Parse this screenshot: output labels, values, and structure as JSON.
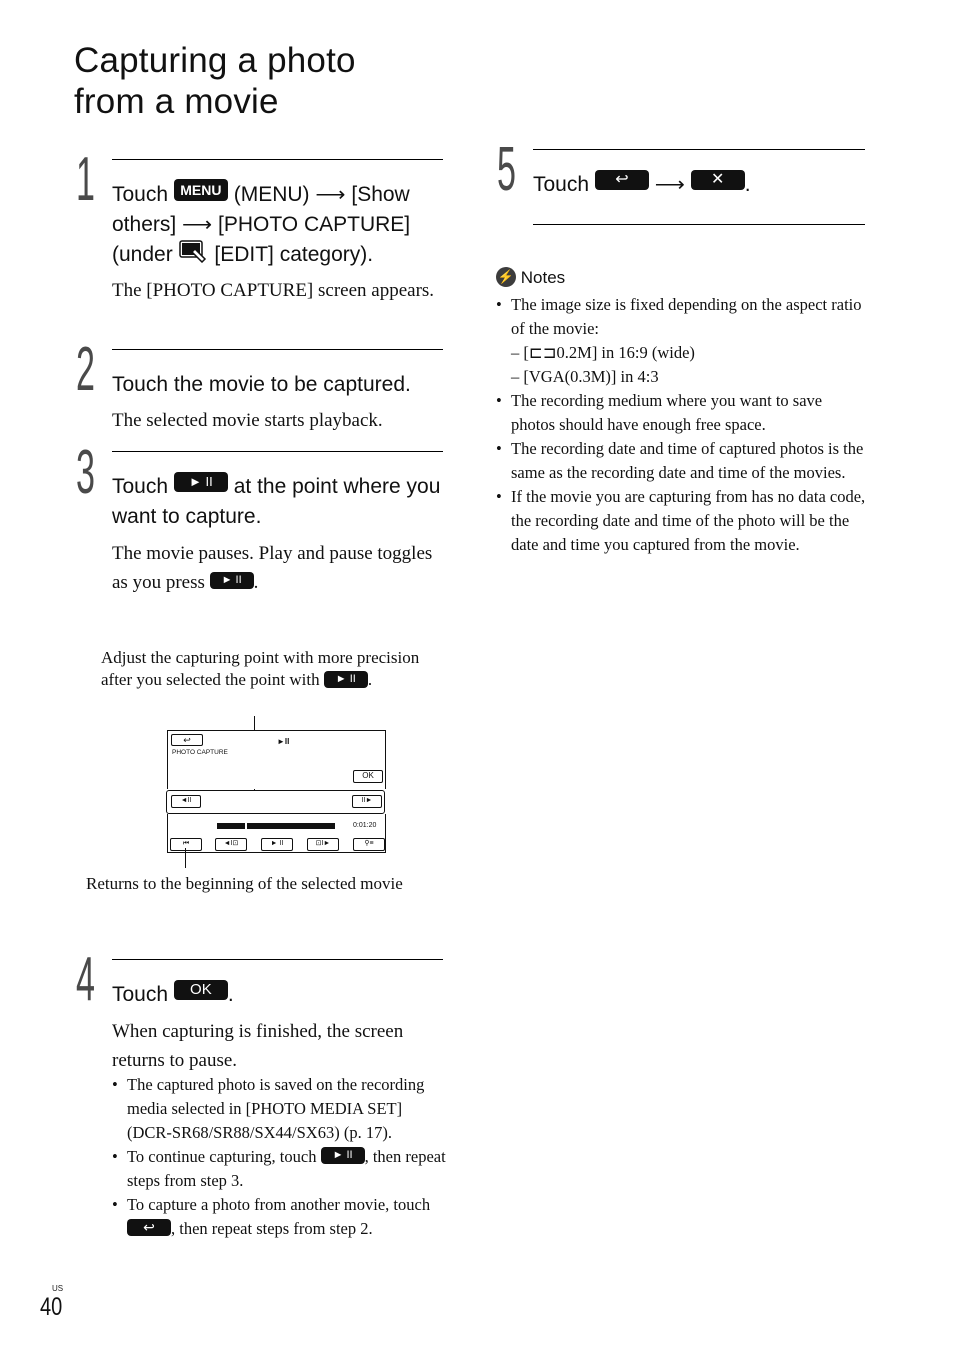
{
  "page": {
    "title_line1": "Capturing a photo",
    "title_line2": "from a movie",
    "region": "US",
    "number": "40"
  },
  "icons": {
    "menu": "MENU",
    "play_pause": "► II",
    "ok": "OK",
    "back": "↩",
    "close": "✕",
    "arrow": "⟶",
    "notes": "⚡"
  },
  "steps": [
    {
      "number": "1",
      "head_parts": [
        "Touch",
        "(MENU)",
        "[Show",
        "others]",
        "[PHOTO CAPTURE]",
        "(under",
        "[EDIT] category)."
      ],
      "body": "The [PHOTO CAPTURE] screen appears."
    },
    {
      "number": "2",
      "head": "Touch the movie to be captured.",
      "body": "The selected movie starts playback."
    },
    {
      "number": "3",
      "head_a": "Touch",
      "head_b": "at the point where you want to capture.",
      "body_a": "The movie pauses. Play and pause toggles as you press",
      "body_b": "."
    },
    {
      "number": "4",
      "head_a": "Touch",
      "head_b": ".",
      "body": "When capturing is finished, the screen returns to pause.",
      "bullets": [
        {
          "text": "The captured photo is saved on the recording media selected in [PHOTO MEDIA SET] (DCR-SR68/SR88/SX44/SX63) (p. 17)."
        },
        {
          "text_a": "To continue capturing, touch",
          "text_b": ", then repeat steps from step 3."
        },
        {
          "text_a": "To capture a photo from another movie, touch",
          "text_b": ", then repeat steps from step 2."
        }
      ]
    },
    {
      "number": "5",
      "head_a": "Touch",
      "head_b": "."
    }
  ],
  "diagram": {
    "caption_top_a": "Adjust the capturing point with more precision after you selected the point with",
    "caption_top_b": ".",
    "caption_bottom": "Returns to the beginning of the selected movie",
    "screen": {
      "back_label": "↩",
      "mode_label": "PHOTO CAPTURE",
      "status_icon": "►II",
      "ok_label": "OK",
      "frame_back_label": "◄II",
      "frame_fwd_label": "II►",
      "time": "0:01:20",
      "progress": 0.24,
      "bottom_buttons": [
        "⏮",
        "◄I⊡",
        "► II",
        "⊡I►",
        "⚲≡"
      ]
    }
  },
  "notes": {
    "heading": "Notes",
    "items": [
      {
        "text": "The image size is fixed depending on the aspect ratio of the movie:",
        "sub": [
          "– [⊏⊐0.2M] in 16:9 (wide)",
          "– [VGA(0.3M)] in 4:3"
        ]
      },
      {
        "text": "The recording medium where you want to save photos should have enough free space."
      },
      {
        "text": "The recording date and time of captured photos is the same as the recording date and time of the movies."
      },
      {
        "text": "If the movie you are capturing from has no data code, the recording date and time of the photo will be the date and time you captured from the movie."
      }
    ]
  }
}
